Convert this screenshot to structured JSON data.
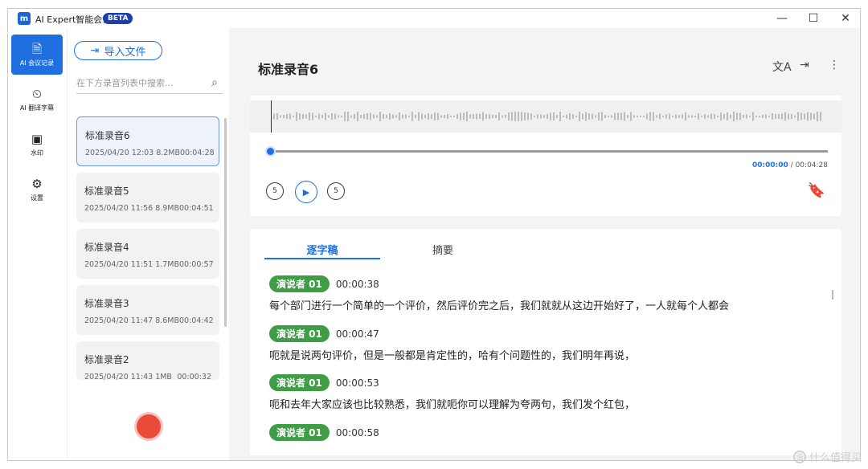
{
  "app": {
    "title": "AI Expert智能会议",
    "badge": "BETA",
    "logo_glyph": "m"
  },
  "window_controls": {
    "minimize": "—",
    "maximize": "☐",
    "close": "✕"
  },
  "nav": {
    "items": [
      {
        "label": "AI 会议记录",
        "icon": "document-icon",
        "glyph": "🗎",
        "active": true
      },
      {
        "label": "AI 翻译字幕",
        "icon": "subtitle-clock-icon",
        "glyph": "⏲",
        "active": false
      },
      {
        "label": "水印",
        "icon": "watermark-icon",
        "glyph": "▣",
        "active": false
      },
      {
        "label": "设置",
        "icon": "gear-icon",
        "glyph": "⚙",
        "active": false
      }
    ]
  },
  "list": {
    "import_label": "导入文件",
    "import_glyph": "⇥",
    "search_placeholder": "在下方录音列表中搜索...",
    "search_glyph": "⌕",
    "items": [
      {
        "name": "标准录音6",
        "date": "2025/04/20 12:03",
        "size": "8.2MB",
        "duration": "00:04:28",
        "selected": true
      },
      {
        "name": "标准录音5",
        "date": "2025/04/20 11:56",
        "size": "8.9MB",
        "duration": "00:04:51",
        "selected": false
      },
      {
        "name": "标准录音4",
        "date": "2025/04/20 11:51",
        "size": "1.7MB",
        "duration": "00:00:57",
        "selected": false
      },
      {
        "name": "标准录音3",
        "date": "2025/04/20 11:47",
        "size": "8.6MB",
        "duration": "00:04:42",
        "selected": false
      },
      {
        "name": "标准录音2",
        "date": "2025/04/20 11:43",
        "size": "1MB",
        "duration": "00:00:32",
        "selected": false
      }
    ]
  },
  "main": {
    "title": "标准录音6",
    "actions": [
      {
        "name": "translate-icon",
        "glyph": "文A"
      },
      {
        "name": "export-icon",
        "glyph": "⇥"
      },
      {
        "name": "more-icon",
        "glyph": "⋮"
      }
    ],
    "player": {
      "current_time": "00:00:00",
      "separator": "/",
      "total_time": "00:04:28",
      "progress": 0,
      "rewind_label": "5",
      "forward_label": "5",
      "play_glyph": "▶",
      "bookmark_glyph": "🔖"
    },
    "tabs": [
      {
        "label": "逐字稿",
        "active": true
      },
      {
        "label": "摘要",
        "active": false
      }
    ],
    "segments": [
      {
        "speaker": "演说者 01",
        "time": "00:00:38",
        "text": "每个部门进行一个简单的一个评价，然后评价完之后，我们就就从这边开始好了，一人就每个人都会"
      },
      {
        "speaker": "演说者 01",
        "time": "00:00:47",
        "text": "呃就是说两句评价，但是一般都是肯定性的，哈有个问题性的，我们明年再说，"
      },
      {
        "speaker": "演说者 01",
        "time": "00:00:53",
        "text": "呃和去年大家应该也比较熟悉，我们就呃你可以理解为夸两句，我们发个红包，"
      },
      {
        "speaker": "演说者 01",
        "time": "00:00:58",
        "text": ""
      }
    ]
  },
  "watermark": {
    "text": "什么值得买",
    "glyph": "值"
  },
  "colors": {
    "accent": "#1f6fe0",
    "speaker": "#3f9d46",
    "record": "#e94a3a"
  }
}
